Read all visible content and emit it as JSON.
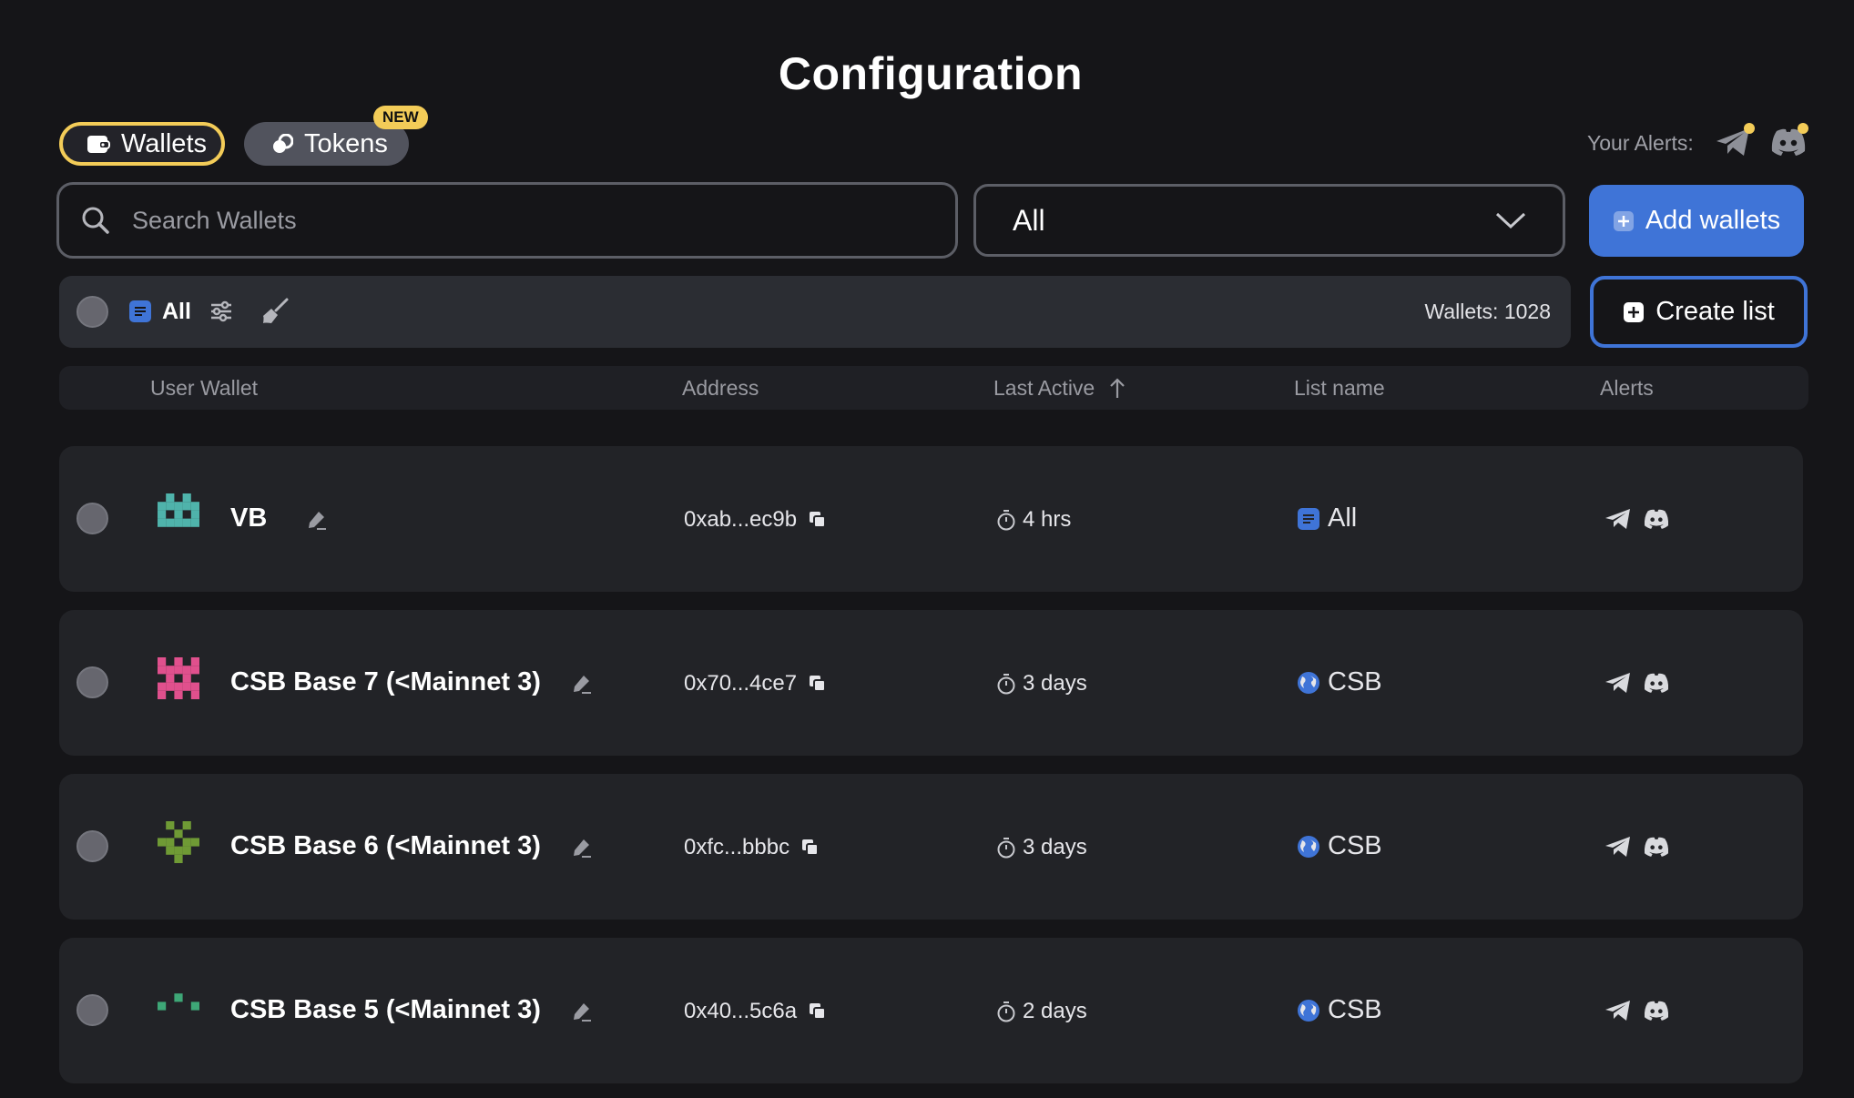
{
  "page": {
    "title": "Configuration"
  },
  "tabs": [
    {
      "label": "Wallets",
      "icon": "wallet-icon",
      "active": true
    },
    {
      "label": "Tokens",
      "icon": "tokens-icon",
      "badge": "NEW"
    }
  ],
  "alerts": {
    "label": "Your Alerts:",
    "icons": [
      "telegram-icon",
      "discord-icon"
    ]
  },
  "search": {
    "placeholder": "Search Wallets",
    "value": ""
  },
  "filter": {
    "selected": "All"
  },
  "buttons": {
    "add_wallets": "Add wallets",
    "create_list": "Create list"
  },
  "toolbar": {
    "all_label": "All",
    "wallet_count": "Wallets: 1028"
  },
  "table": {
    "columns": [
      "User Wallet",
      "Address",
      "Last Active",
      "List name",
      "Alerts"
    ],
    "sort": {
      "column": "Last Active",
      "direction": "ascending"
    },
    "rows": [
      {
        "name": "VB",
        "address": "0xab...ec9b",
        "last_active": "4 hrs",
        "list": "All",
        "list_icon": "list-icon",
        "avatar_color": "#4fb3ab"
      },
      {
        "name": "CSB Base 7 (<Mainnet 3)",
        "address": "0x70...4ce7",
        "last_active": "3 days",
        "list": "CSB",
        "list_icon": "globe-icon",
        "avatar_color": "#e0508d"
      },
      {
        "name": "CSB Base 6 (<Mainnet 3)",
        "address": "0xfc...bbbc",
        "last_active": "3 days",
        "list": "CSB",
        "list_icon": "globe-icon",
        "avatar_color": "#6f9a35"
      },
      {
        "name": "CSB Base 5 (<Mainnet 3)",
        "address": "0x40...5c6a",
        "last_active": "2 days",
        "list": "CSB",
        "list_icon": "globe-icon",
        "avatar_color": "#3ea777"
      }
    ]
  },
  "colors": {
    "accent": "#3f74d7",
    "highlight": "#f3cc58",
    "background": "#151518"
  }
}
